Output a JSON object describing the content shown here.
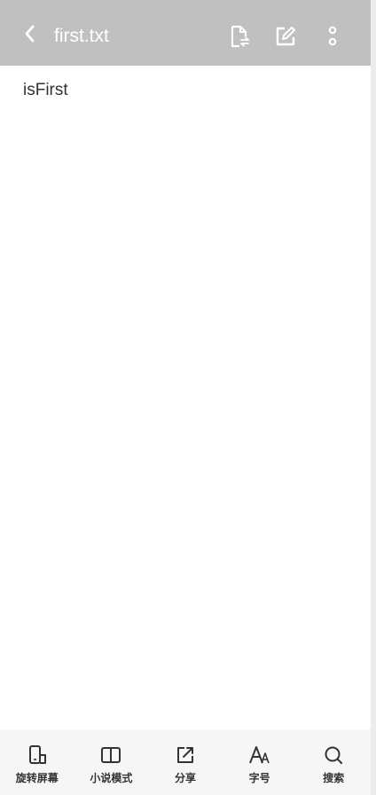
{
  "header": {
    "title": "first.txt",
    "background": "#c0c0c0",
    "icons": [
      "back-icon",
      "file-convert-icon",
      "edit-icon",
      "more-vertical-icon"
    ]
  },
  "document": {
    "text": "isFirst"
  },
  "toolbar": {
    "items": [
      {
        "label": "旋转屏幕",
        "icon": "rotate-screen-icon"
      },
      {
        "label": "小说模式",
        "icon": "book-icon"
      },
      {
        "label": "分享",
        "icon": "share-icon"
      },
      {
        "label": "字号",
        "icon": "font-size-icon"
      },
      {
        "label": "搜索",
        "icon": "search-icon"
      }
    ]
  }
}
